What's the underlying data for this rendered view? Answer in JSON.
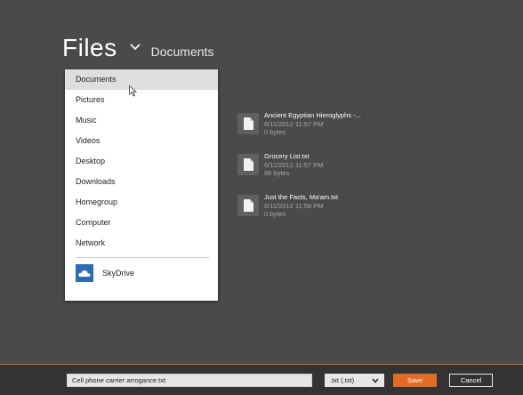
{
  "header": {
    "title": "Files",
    "location": "Documents"
  },
  "locations": [
    {
      "label": "Documents",
      "selected": true
    },
    {
      "label": "Pictures"
    },
    {
      "label": "Music"
    },
    {
      "label": "Videos"
    },
    {
      "label": "Desktop"
    },
    {
      "label": "Downloads"
    },
    {
      "label": "Homegroup"
    },
    {
      "label": "Computer"
    },
    {
      "label": "Network"
    }
  ],
  "skydrive": {
    "label": "SkyDrive",
    "icon": "skydrive-icon"
  },
  "files": [
    {
      "name": "Ancient Egyptian Hieroglyphs -...",
      "date": "6/11/2012 11:57 PM",
      "size": "0 bytes",
      "icon": "text-document-icon"
    },
    {
      "name": "Grocery List.txt",
      "date": "6/11/2012 11:57 PM",
      "size": "88 bytes",
      "icon": "text-document-icon"
    },
    {
      "name": "Just the Facts, Ma'am.txt",
      "date": "6/11/2012 11:58 PM",
      "size": "0 bytes",
      "icon": "text-document-icon"
    }
  ],
  "bottom": {
    "filename": "Cell phone carrier arrogance.txt",
    "file_type": ".txt (.txt)",
    "save_label": "Save",
    "cancel_label": "Cancel"
  },
  "colors": {
    "background": "#4a4a4a",
    "accent": "#e46c22",
    "bottom_bar": "#333333",
    "skydrive_blue": "#2a6bb7"
  }
}
